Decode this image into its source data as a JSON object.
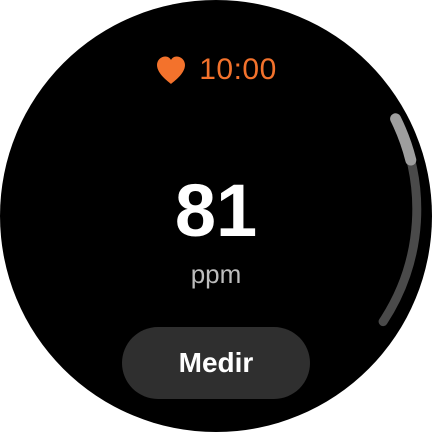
{
  "header": {
    "icon": "heart-icon",
    "time": "10:00"
  },
  "reading": {
    "value": "81",
    "unit": "ppm"
  },
  "actions": {
    "measure_label": "Medir"
  },
  "scroll": {
    "thumb_position": "top"
  },
  "colors": {
    "accent": "#F3722C",
    "background": "#000000",
    "button": "#2F2F2F",
    "unit_text": "#BDBDBD",
    "scroll_thumb": "#9E9E9E",
    "scroll_track": "#4A4A4A"
  }
}
